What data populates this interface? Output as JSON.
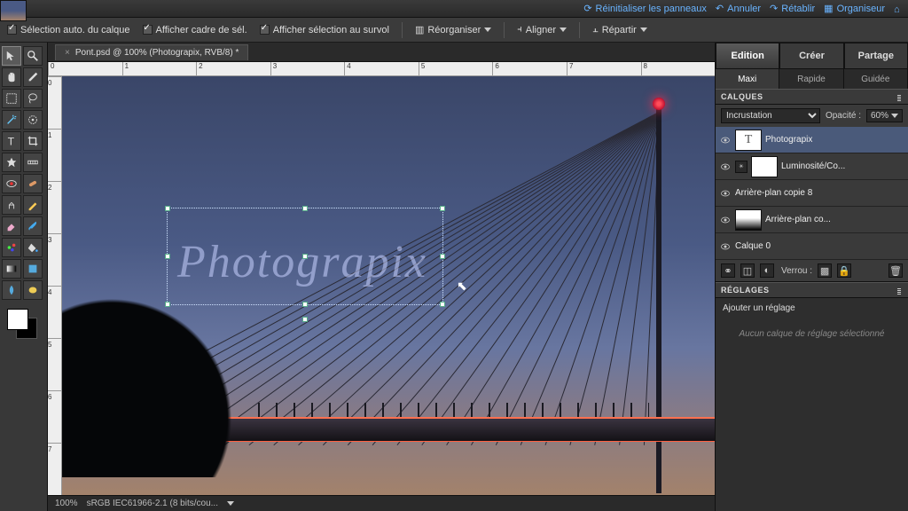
{
  "topbar": {
    "reset": "Réinitialiser les panneaux",
    "undo": "Annuler",
    "redo": "Rétablir",
    "organizer": "Organiseur"
  },
  "options": {
    "autoSelect": "Sélection auto. du calque",
    "showFrame": "Afficher cadre de sél.",
    "showHover": "Afficher sélection au survol",
    "reorganize": "Réorganiser",
    "align": "Aligner",
    "distribute": "Répartir"
  },
  "doc": {
    "tabTitle": "Pont.psd @ 100% (Photograpix, RVB/8) *",
    "zoom": "100%",
    "profile": "sRGB IEC61966-2.1 (8 bits/cou..."
  },
  "canvas": {
    "textContent": "Photograpix"
  },
  "rulerH": [
    "0",
    "1",
    "2",
    "3",
    "4",
    "5",
    "6",
    "7",
    "8"
  ],
  "rulerV": [
    "0",
    "1",
    "2",
    "3",
    "4",
    "5",
    "6",
    "7"
  ],
  "modes": {
    "edit": "Edition",
    "create": "Créer",
    "share": "Partage"
  },
  "submodes": {
    "maxi": "Maxi",
    "rapid": "Rapide",
    "guided": "Guidée"
  },
  "panels": {
    "layersTitle": "CALQUES",
    "blend": "Incrustation",
    "opacityLabel": "Opacité :",
    "opacityValue": "60%",
    "lockLabel": "Verrou :",
    "adjustTitle": "RÉGLAGES",
    "addAdjust": "Ajouter un réglage",
    "noAdjust": "Aucun calque de réglage sélectionné"
  },
  "layers": [
    {
      "name": "Photograpix",
      "type": "text",
      "selected": true
    },
    {
      "name": "Luminosité/Co...",
      "type": "adjust"
    },
    {
      "name": "Arrière-plan copie 8",
      "type": "image"
    },
    {
      "name": "Arrière-plan co...",
      "type": "imagemask"
    },
    {
      "name": "Calque 0",
      "type": "image"
    }
  ]
}
